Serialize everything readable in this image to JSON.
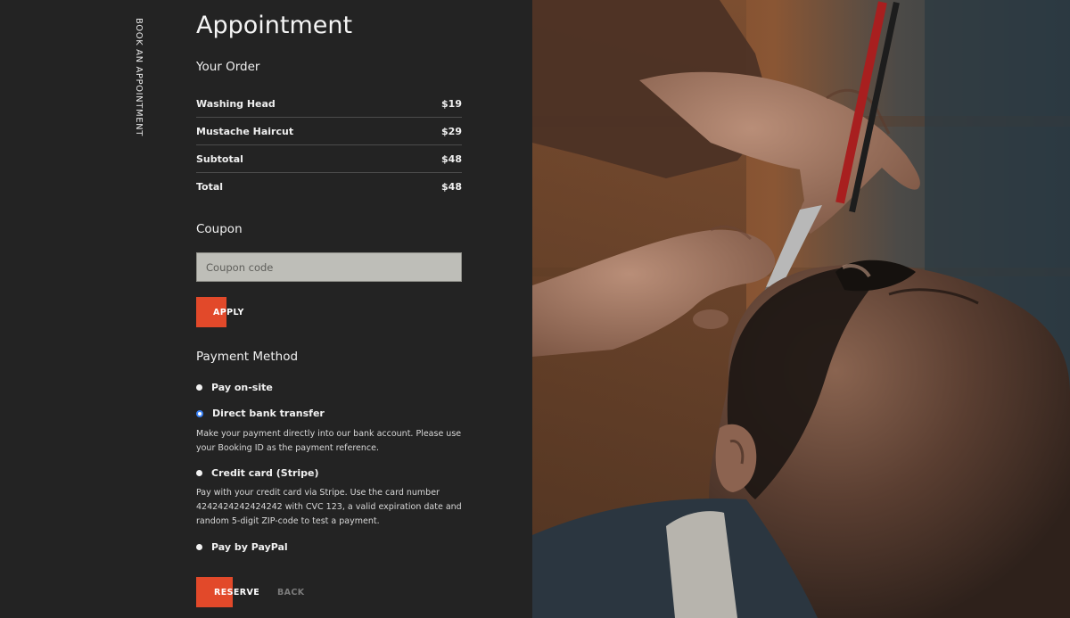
{
  "sidebar": {
    "label": "Book an Appointment"
  },
  "page": {
    "title": "Appointment"
  },
  "order": {
    "heading": "Your Order",
    "rows": [
      {
        "label": "Washing Head",
        "value": "$19"
      },
      {
        "label": "Mustache Haircut",
        "value": "$29"
      },
      {
        "label": "Subtotal",
        "value": "$48"
      },
      {
        "label": "Total",
        "value": "$48"
      }
    ]
  },
  "coupon": {
    "heading": "Coupon",
    "placeholder": "Coupon code",
    "apply_label": "APPLY"
  },
  "payment": {
    "heading": "Payment Method",
    "options": [
      {
        "label": "Pay on-site",
        "selected": false,
        "description": ""
      },
      {
        "label": "Direct bank transfer",
        "selected": true,
        "description": "Make your payment directly into our bank account. Please use your Booking ID as the payment reference."
      },
      {
        "label": "Credit card (Stripe)",
        "selected": false,
        "description": "Pay with your credit card via Stripe. Use the card number 4242424242424242 with CVC 123, a valid expiration date and random 5-digit ZIP-code to test a payment."
      },
      {
        "label": "Pay by PayPal",
        "selected": false,
        "description": ""
      }
    ]
  },
  "actions": {
    "reserve_label": "RESERVE",
    "back_label": "BACK"
  },
  "colors": {
    "background": "#232323",
    "accent": "#e2492a",
    "input_bg": "#bebeb8",
    "radio_selected": "#3b82f6"
  },
  "hero": {
    "image_subject": "barber-shaving-beard-photo"
  }
}
